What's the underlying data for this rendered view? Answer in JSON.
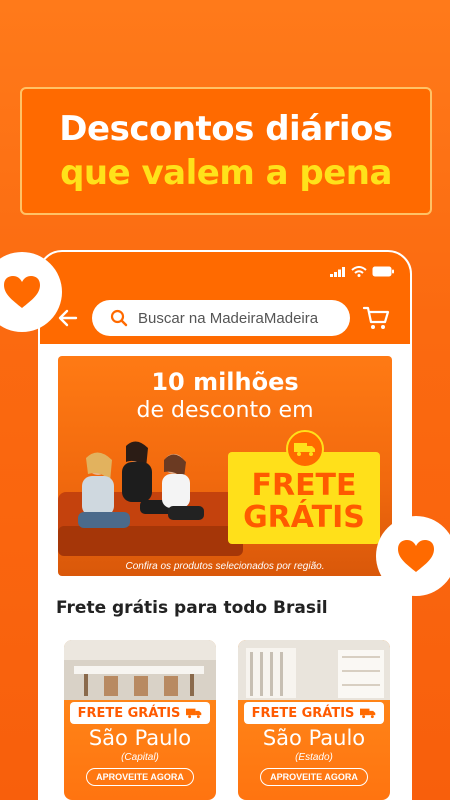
{
  "headline": {
    "line1": "Descontos diários",
    "line2": "que valem a pena"
  },
  "icons": {
    "heart_left": "heart-icon",
    "heart_right": "heart-icon",
    "back": "arrow-left-icon",
    "search": "search-icon",
    "cart": "cart-icon",
    "signal": "signal-icon",
    "wifi": "wifi-icon",
    "battery": "battery-icon",
    "truck": "truck-icon"
  },
  "search": {
    "placeholder": "Buscar na MadeiraMadeira"
  },
  "banner": {
    "title_line1": "10 milhões",
    "title_line2": "de desconto em",
    "badge_line1": "FRETE",
    "badge_line2": "GRÁTIS",
    "note": "Confira os produtos selecionados por região."
  },
  "section": {
    "title": "Frete grátis para todo Brasil"
  },
  "cards": [
    {
      "tag": "FRETE GRÁTIS",
      "city": "São Paulo",
      "region": "(Capital)",
      "cta": "APROVEITE AGORA"
    },
    {
      "tag": "FRETE GRÁTIS",
      "city": "São Paulo",
      "region": "(Estado)",
      "cta": "APROVEITE AGORA"
    }
  ],
  "colors": {
    "brand_orange": "#ff6a00",
    "accent_yellow": "#ffe21a",
    "white": "#ffffff"
  }
}
